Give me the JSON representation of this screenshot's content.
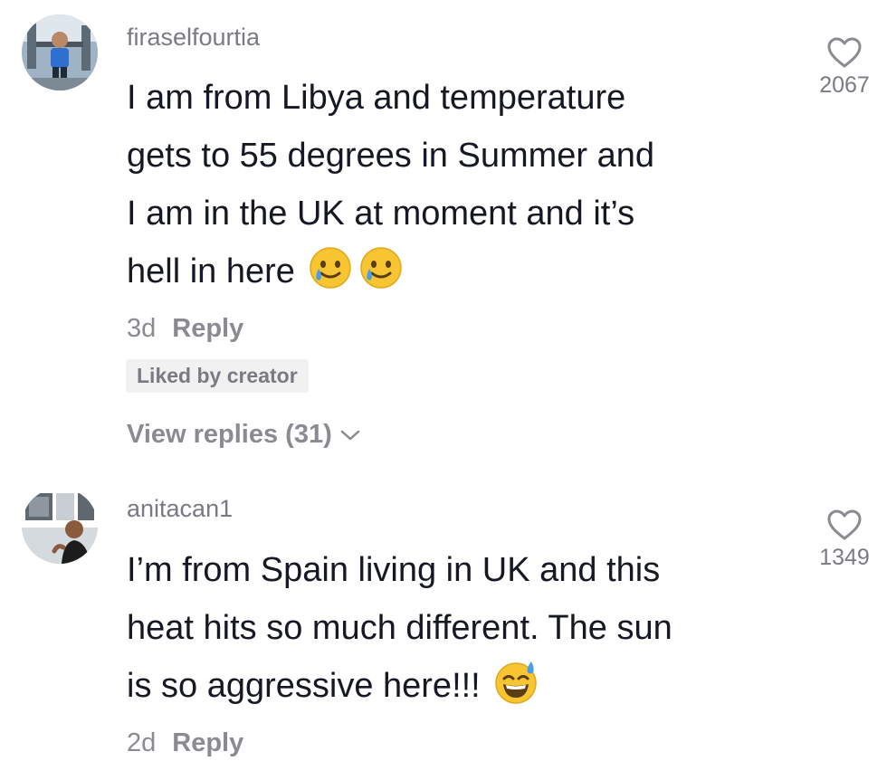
{
  "comments": [
    {
      "username": "firaselfourtia",
      "text_lines": [
        "I am from Libya and temperature",
        "gets to 55 degrees in Summer and",
        "I am in the UK at moment and it’s",
        "hell in here"
      ],
      "emojis": [
        "smiling-face-with-tear-icon",
        "smiling-face-with-tear-icon"
      ],
      "time": "3d",
      "reply_label": "Reply",
      "liked_label": "Liked by creator",
      "view_replies_label": "View replies (31)",
      "like_count": "2067"
    },
    {
      "username": "anitacan1",
      "text_lines": [
        "I’m from Spain living in UK and this",
        "heat hits so much different. The sun",
        "is so aggressive here!!!"
      ],
      "emojis": [
        "grinning-face-with-sweat-icon"
      ],
      "time": "2d",
      "reply_label": "Reply",
      "like_count": "1349"
    }
  ]
}
